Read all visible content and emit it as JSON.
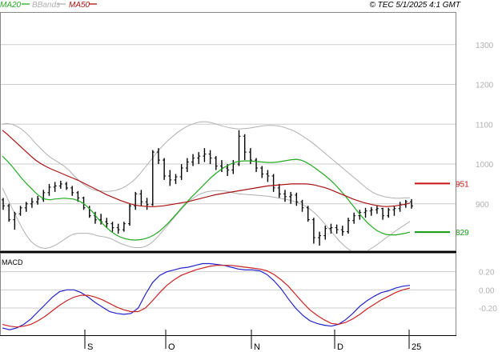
{
  "header": {
    "legend": [
      {
        "label": "MA20",
        "color": "#22aa22"
      },
      {
        "label": "BBands",
        "color": "#b0b0b0"
      },
      {
        "label": "MA50",
        "color": "#aa1111"
      }
    ],
    "source": "© TEC 5/1/2025 4:1 GMT"
  },
  "chart_data": [
    {
      "type": "line",
      "panel": "price",
      "y_ticks": [
        "1300",
        "1200",
        "1100",
        "1000",
        "900"
      ],
      "ylim": [
        783,
        1380
      ],
      "x_ticks": [
        "S",
        "O",
        "N",
        "D",
        "25"
      ],
      "grid": true,
      "series": [
        {
          "name": "MA20",
          "color": "#22aa22",
          "values": [
            1020,
            1008,
            995,
            980,
            965,
            952,
            940,
            928,
            918,
            912,
            910,
            912,
            913,
            914,
            913,
            912,
            908,
            902,
            892,
            880,
            865,
            852,
            840,
            830,
            822,
            816,
            812,
            810,
            809,
            810,
            812,
            816,
            822,
            830,
            840,
            852,
            865,
            878,
            892,
            905,
            918,
            930,
            942,
            954,
            966,
            976,
            985,
            993,
            999,
            1004,
            1007,
            1008,
            1008,
            1007,
            1006,
            1005,
            1004,
            1004,
            1005,
            1007,
            1009,
            1011,
            1012,
            1010,
            1005,
            998,
            990,
            981,
            972,
            962,
            951,
            938,
            925,
            910,
            895,
            880,
            866,
            853,
            842,
            833,
            827,
            823,
            822,
            822,
            824,
            826,
            829
          ]
        },
        {
          "name": "MA50",
          "color": "#aa1111",
          "values": [
            1085,
            1075,
            1064,
            1053,
            1042,
            1031,
            1020,
            1010,
            1002,
            995,
            989,
            984,
            979,
            974,
            969,
            964,
            959,
            953,
            947,
            941,
            935,
            929,
            923,
            918,
            913,
            908,
            904,
            900,
            897,
            895,
            894,
            893,
            893,
            894,
            895,
            897,
            899,
            901,
            903,
            905,
            908,
            911,
            914,
            917,
            920,
            923,
            925,
            927,
            929,
            931,
            933,
            935,
            937,
            939,
            941,
            943,
            945,
            946,
            947,
            948,
            949,
            950,
            950,
            950,
            950,
            949,
            947,
            944,
            941,
            937,
            932,
            927,
            922,
            917,
            912,
            908,
            904,
            901,
            898,
            896,
            894,
            893,
            894,
            895,
            897,
            899,
            902
          ]
        },
        {
          "name": "BBand upper",
          "color": "#b0b0b0",
          "values": [
            1100,
            1102,
            1100,
            1095,
            1088,
            1078,
            1066,
            1052,
            1040,
            1028,
            1018,
            1010,
            1003,
            995,
            985,
            972,
            960,
            950,
            942,
            936,
            933,
            932,
            931,
            932,
            934,
            938,
            944,
            952,
            962,
            975,
            990,
            1005,
            1020,
            1035,
            1048,
            1060,
            1070,
            1080,
            1088,
            1095,
            1100,
            1104,
            1106,
            1106,
            1104,
            1101,
            1097,
            1094,
            1091,
            1089,
            1088,
            1089,
            1090,
            1092,
            1094,
            1096,
            1097,
            1097,
            1096,
            1094,
            1090,
            1086,
            1080,
            1073,
            1065,
            1057,
            1048,
            1038,
            1028,
            1018,
            1008,
            998,
            988,
            978,
            968,
            958,
            948,
            938,
            930,
            924,
            920,
            917,
            915,
            914,
            914,
            915,
            915
          ]
        },
        {
          "name": "BBand lower",
          "color": "#b0b0b0",
          "values": [
            940,
            915,
            890,
            866,
            842,
            822,
            806,
            796,
            790,
            788,
            790,
            795,
            802,
            810,
            818,
            824,
            826,
            826,
            826,
            824,
            820,
            818,
            816,
            812,
            806,
            800,
            796,
            792,
            790,
            790,
            792,
            798,
            808,
            820,
            834,
            848,
            862,
            876,
            890,
            902,
            912,
            920,
            926,
            930,
            932,
            933,
            933,
            932,
            930,
            927,
            925,
            924,
            923,
            922,
            921,
            920,
            919,
            917,
            915,
            913,
            911,
            908,
            904,
            900,
            894,
            886,
            876,
            864,
            850,
            836,
            822,
            808,
            796,
            786,
            780,
            777,
            778,
            782,
            789,
            797,
            806,
            815,
            823,
            832,
            840,
            848,
            856
          ]
        }
      ]
    },
    {
      "type": "line",
      "panel": "macd",
      "title": "MACD",
      "y_ticks": [
        "0.20",
        "0.00",
        "-0.20"
      ],
      "ylim": [
        -0.5,
        0.4
      ],
      "series": [
        {
          "name": "MACD",
          "color": "#2222cc",
          "values": [
            -0.42,
            -0.44,
            -0.42,
            -0.38,
            -0.32,
            -0.24,
            -0.16,
            -0.08,
            -0.02,
            0.0,
            0.0,
            -0.03,
            -0.08,
            -0.14,
            -0.19,
            -0.24,
            -0.26,
            -0.27,
            -0.26,
            -0.2,
            -0.05,
            0.08,
            0.16,
            0.2,
            0.22,
            0.24,
            0.25,
            0.27,
            0.29,
            0.29,
            0.28,
            0.27,
            0.25,
            0.23,
            0.22,
            0.22,
            0.21,
            0.17,
            0.1,
            0.01,
            -0.1,
            -0.2,
            -0.28,
            -0.34,
            -0.37,
            -0.39,
            -0.4,
            -0.38,
            -0.33,
            -0.26,
            -0.18,
            -0.12,
            -0.07,
            -0.03,
            -0.01,
            0.02,
            0.04,
            0.05
          ]
        },
        {
          "name": "Signal",
          "color": "#cc2222",
          "values": [
            -0.38,
            -0.4,
            -0.41,
            -0.4,
            -0.38,
            -0.34,
            -0.29,
            -0.23,
            -0.17,
            -0.12,
            -0.08,
            -0.06,
            -0.06,
            -0.08,
            -0.11,
            -0.15,
            -0.19,
            -0.22,
            -0.24,
            -0.24,
            -0.2,
            -0.12,
            -0.03,
            0.05,
            0.11,
            0.16,
            0.19,
            0.22,
            0.24,
            0.26,
            0.27,
            0.27,
            0.27,
            0.26,
            0.25,
            0.24,
            0.23,
            0.21,
            0.17,
            0.11,
            0.04,
            -0.05,
            -0.14,
            -0.22,
            -0.28,
            -0.33,
            -0.37,
            -0.38,
            -0.36,
            -0.32,
            -0.27,
            -0.21,
            -0.16,
            -0.11,
            -0.07,
            -0.03,
            0.0,
            0.02
          ]
        }
      ]
    }
  ],
  "ohlc": [
    [
      910,
      915,
      885,
      895
    ],
    [
      895,
      900,
      855,
      860
    ],
    [
      860,
      880,
      835,
      875
    ],
    [
      875,
      895,
      870,
      890
    ],
    [
      890,
      905,
      880,
      900
    ],
    [
      900,
      915,
      890,
      905
    ],
    [
      905,
      920,
      898,
      912
    ],
    [
      912,
      935,
      905,
      928
    ],
    [
      928,
      950,
      920,
      942
    ],
    [
      942,
      955,
      930,
      945
    ],
    [
      945,
      958,
      938,
      950
    ],
    [
      950,
      955,
      935,
      940
    ],
    [
      940,
      945,
      920,
      928
    ],
    [
      928,
      932,
      905,
      915
    ],
    [
      915,
      918,
      885,
      890
    ],
    [
      890,
      895,
      865,
      870
    ],
    [
      870,
      880,
      850,
      860
    ],
    [
      860,
      875,
      848,
      855
    ],
    [
      855,
      865,
      840,
      850
    ],
    [
      850,
      855,
      830,
      840
    ],
    [
      840,
      850,
      825,
      835
    ],
    [
      835,
      855,
      830,
      850
    ],
    [
      850,
      900,
      845,
      895
    ],
    [
      895,
      930,
      885,
      925
    ],
    [
      925,
      935,
      895,
      905
    ],
    [
      905,
      915,
      885,
      898
    ],
    [
      898,
      1035,
      895,
      1030
    ],
    [
      1030,
      1040,
      1000,
      1010
    ],
    [
      1010,
      1015,
      960,
      970
    ],
    [
      970,
      985,
      945,
      960
    ],
    [
      960,
      975,
      950,
      968
    ],
    [
      968,
      1000,
      960,
      990
    ],
    [
      990,
      1015,
      980,
      1005
    ],
    [
      1005,
      1025,
      995,
      1015
    ],
    [
      1015,
      1030,
      1000,
      1020
    ],
    [
      1020,
      1040,
      1005,
      1025
    ],
    [
      1025,
      1035,
      1000,
      1015
    ],
    [
      1015,
      1020,
      985,
      995
    ],
    [
      995,
      1010,
      980,
      990
    ],
    [
      990,
      1000,
      970,
      985
    ],
    [
      985,
      1010,
      975,
      1000
    ],
    [
      1000,
      1085,
      995,
      1070
    ],
    [
      1070,
      1075,
      1010,
      1030
    ],
    [
      1030,
      1040,
      1000,
      1010
    ],
    [
      1010,
      1015,
      980,
      990
    ],
    [
      990,
      995,
      965,
      975
    ],
    [
      975,
      985,
      955,
      970
    ],
    [
      970,
      975,
      930,
      940
    ],
    [
      940,
      950,
      915,
      925
    ],
    [
      925,
      935,
      905,
      918
    ],
    [
      918,
      930,
      900,
      922
    ],
    [
      922,
      928,
      895,
      905
    ],
    [
      905,
      910,
      880,
      890
    ],
    [
      890,
      895,
      855,
      860
    ],
    [
      860,
      865,
      800,
      815
    ],
    [
      815,
      830,
      795,
      820
    ],
    [
      820,
      845,
      810,
      838
    ],
    [
      838,
      850,
      825,
      840
    ],
    [
      840,
      848,
      825,
      835
    ],
    [
      835,
      845,
      820,
      830
    ],
    [
      830,
      865,
      825,
      858
    ],
    [
      858,
      878,
      850,
      870
    ],
    [
      870,
      885,
      860,
      878
    ],
    [
      878,
      890,
      865,
      882
    ],
    [
      882,
      892,
      870,
      885
    ],
    [
      885,
      895,
      875,
      888
    ],
    [
      888,
      890,
      860,
      870
    ],
    [
      870,
      890,
      865,
      885
    ],
    [
      885,
      895,
      870,
      888
    ],
    [
      888,
      905,
      880,
      898
    ],
    [
      898,
      910,
      890,
      905
    ],
    [
      905,
      912,
      888,
      895
    ]
  ],
  "levels": [
    {
      "label": "951",
      "value": 951,
      "color": "#cc1111"
    },
    {
      "label": "829",
      "value": 829,
      "color": "#119911"
    }
  ]
}
